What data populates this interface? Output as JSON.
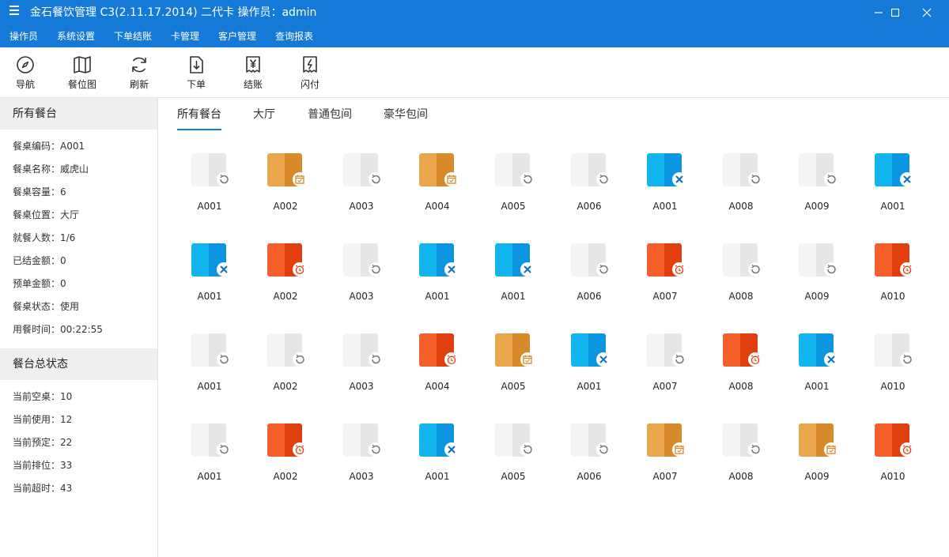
{
  "window": {
    "title": "金石餐饮管理  C3(2.11.17.2014) 二代卡 操作员：admin"
  },
  "menubar": [
    "操作员",
    "系统设置",
    "下单结账",
    "卡管理",
    "客户管理",
    "查询报表"
  ],
  "toolbar": [
    {
      "label": "导航",
      "icon": "compass-icon"
    },
    {
      "label": "餐位图",
      "icon": "map-icon"
    },
    {
      "label": "刷新",
      "icon": "refresh-icon"
    },
    {
      "label": "下单",
      "icon": "order-download-icon"
    },
    {
      "label": "结账",
      "icon": "yen-receipt-icon"
    },
    {
      "label": "闪付",
      "icon": "flash-pay-icon"
    }
  ],
  "sidebar": {
    "table_section_title": "所有餐台",
    "table_info": [
      "餐桌编码：A001",
      "餐桌名称：威虎山",
      "餐桌容量：6",
      "餐桌位置：大厅",
      "就餐人数：1/6",
      "已结金额：0",
      "预单金额：0",
      "餐桌状态：使用",
      "用餐时间：00:22:55"
    ],
    "status_section_title": "餐台总状态",
    "status_info": [
      "当前空桌：10",
      "当前使用：12",
      "当前预定：22",
      "当前排位：33",
      "当前超时：43"
    ]
  },
  "tabs": [
    "所有餐台",
    "大厅",
    "普通包间",
    "豪华包间"
  ],
  "status_colors": {
    "empty": "#e6e6e6",
    "booked": "#d8892a",
    "inuse": "#0c95e0",
    "overtime": "#e04010",
    "accent": "#1479d7"
  },
  "tables": [
    [
      {
        "name": "A001",
        "status": "empty"
      },
      {
        "name": "A002",
        "status": "booked"
      },
      {
        "name": "A003",
        "status": "empty"
      },
      {
        "name": "A004",
        "status": "booked"
      },
      {
        "name": "A005",
        "status": "empty"
      },
      {
        "name": "A006",
        "status": "empty"
      },
      {
        "name": "A001",
        "status": "inuse"
      },
      {
        "name": "A008",
        "status": "empty"
      },
      {
        "name": "A009",
        "status": "empty"
      },
      {
        "name": "A001",
        "status": "inuse"
      }
    ],
    [
      {
        "name": "A001",
        "status": "inuse"
      },
      {
        "name": "A002",
        "status": "overtime"
      },
      {
        "name": "A003",
        "status": "empty"
      },
      {
        "name": "A001",
        "status": "inuse"
      },
      {
        "name": "A001",
        "status": "inuse"
      },
      {
        "name": "A006",
        "status": "empty"
      },
      {
        "name": "A007",
        "status": "overtime"
      },
      {
        "name": "A008",
        "status": "empty"
      },
      {
        "name": "A009",
        "status": "empty"
      },
      {
        "name": "A010",
        "status": "overtime"
      }
    ],
    [
      {
        "name": "A001",
        "status": "empty"
      },
      {
        "name": "A002",
        "status": "empty"
      },
      {
        "name": "A003",
        "status": "empty"
      },
      {
        "name": "A004",
        "status": "overtime"
      },
      {
        "name": "A005",
        "status": "booked"
      },
      {
        "name": "A001",
        "status": "inuse"
      },
      {
        "name": "A007",
        "status": "empty"
      },
      {
        "name": "A008",
        "status": "overtime"
      },
      {
        "name": "A001",
        "status": "inuse"
      },
      {
        "name": "A010",
        "status": "empty"
      }
    ],
    [
      {
        "name": "A001",
        "status": "empty"
      },
      {
        "name": "A002",
        "status": "overtime"
      },
      {
        "name": "A003",
        "status": "empty"
      },
      {
        "name": "A001",
        "status": "inuse"
      },
      {
        "name": "A005",
        "status": "empty"
      },
      {
        "name": "A006",
        "status": "empty"
      },
      {
        "name": "A007",
        "status": "booked"
      },
      {
        "name": "A008",
        "status": "empty"
      },
      {
        "name": "A009",
        "status": "booked"
      },
      {
        "name": "A010",
        "status": "overtime"
      }
    ]
  ]
}
